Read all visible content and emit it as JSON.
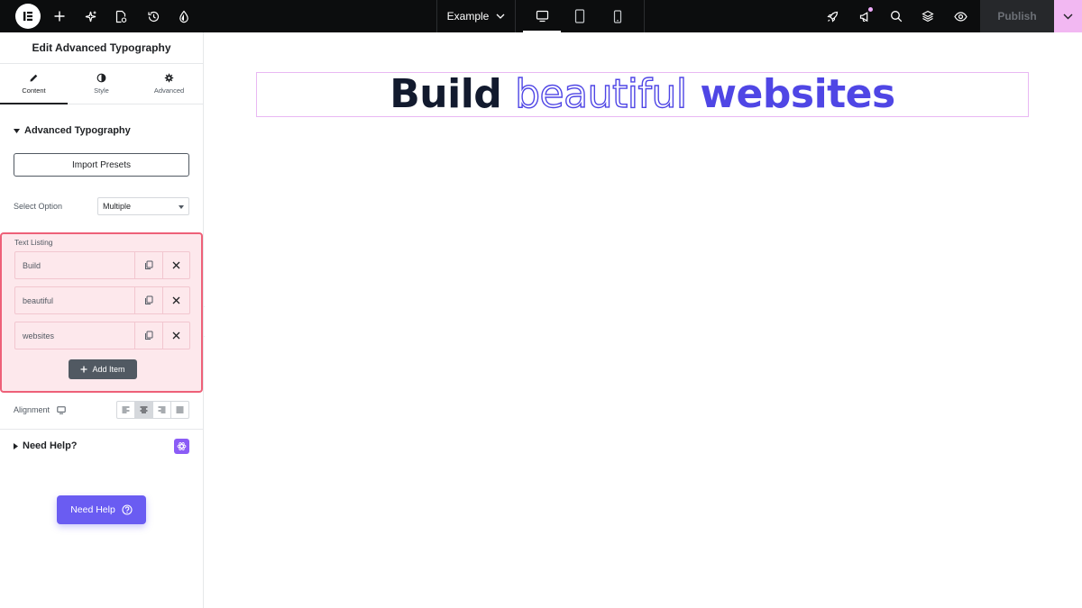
{
  "topbar": {
    "page_name": "Example",
    "publish_label": "Publish",
    "icons": [
      "elementor-logo-icon",
      "add-icon",
      "sparkle-icon",
      "page-settings-icon",
      "history-icon",
      "site-settings-icon",
      "rocket-icon",
      "announcement-icon",
      "search-icon",
      "layers-icon",
      "preview-eye-icon"
    ],
    "devices": [
      "desktop",
      "tablet",
      "mobile"
    ],
    "active_device": "desktop"
  },
  "panel": {
    "title": "Edit Advanced Typography",
    "tabs": [
      {
        "label": "Content",
        "icon": "pencil-icon",
        "active": true
      },
      {
        "label": "Style",
        "icon": "contrast-icon",
        "active": false
      },
      {
        "label": "Advanced",
        "icon": "gear-icon",
        "active": false
      }
    ],
    "section_title": "Advanced Typography",
    "import_label": "Import Presets",
    "select_option_label": "Select Option",
    "select_option_value": "Multiple",
    "text_listing_label": "Text Listing",
    "items": [
      {
        "label": "Build"
      },
      {
        "label": "beautiful"
      },
      {
        "label": "websites"
      }
    ],
    "add_item_label": "Add Item",
    "alignment_label": "Alignment",
    "alignment_active": "center",
    "need_help_section": "Need Help?",
    "need_help_button": "Need Help"
  },
  "canvas": {
    "headline": {
      "word1": "Build",
      "word2": "beautiful",
      "word3": "websites"
    }
  },
  "colors": {
    "topbar_bg": "#0c0d0e",
    "accent": "#4f46e5",
    "highlight_border": "#ee6078",
    "highlight_bg": "#fde8ec",
    "widget_outline": "#e9b8f3",
    "help_button": "#6a5cf2"
  }
}
